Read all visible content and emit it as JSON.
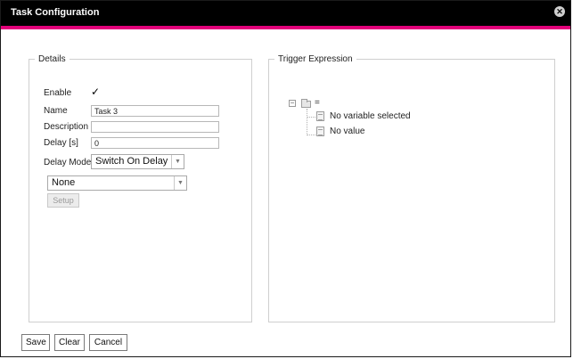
{
  "dialog": {
    "title": "Task Configuration",
    "close_icon": "close-icon",
    "accent_color": "#e2007a"
  },
  "details": {
    "legend": "Details",
    "enable_label": "Enable",
    "enable_checked": true,
    "enable_check_glyph": "✓",
    "name_label": "Name",
    "name_value": "Task 3",
    "description_label": "Description",
    "description_value": "",
    "delay_label": "Delay [s]",
    "delay_value": "0",
    "delay_mode_label": "Delay Mode",
    "delay_mode_value": "Switch On Delay",
    "select_value": "None",
    "setup_label": "Setup"
  },
  "trigger": {
    "legend": "Trigger Expression",
    "root_toggle": "−",
    "root_label": "=",
    "children": [
      {
        "label": "No variable selected"
      },
      {
        "label": "No value"
      }
    ]
  },
  "footer": {
    "save_label": "Save",
    "clear_label": "Clear",
    "cancel_label": "Cancel"
  }
}
